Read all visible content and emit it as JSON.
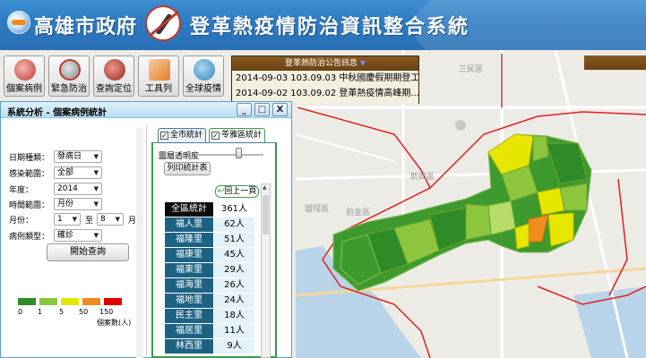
{
  "header": {
    "gov_title": "高雄市政府",
    "system_title": "登革熱疫情防治資訊整合系統"
  },
  "toolbar": {
    "items": [
      {
        "label": "個案病例",
        "icon": "case-chart-icon",
        "color": "#c0392b"
      },
      {
        "label": "緊急防治",
        "icon": "mosquito-ban-icon",
        "color": "#7f8c8d"
      },
      {
        "label": "查詢定位",
        "icon": "locate-pin-icon",
        "color": "#c0392b"
      },
      {
        "label": "工具列",
        "icon": "tools-icon",
        "color": "#e67e22"
      },
      {
        "label": "全球疫情",
        "icon": "globe-search-icon",
        "color": "#2e86c1"
      }
    ]
  },
  "bulletin": {
    "title": "登革熱防治公告訊息",
    "lines": [
      "2014-09-03 103.09.03 中秋國慶假期期登工",
      "2014-09-02 103.09.02 登革熱疫情高峰期..."
    ]
  },
  "panel": {
    "title": "系統分析 - 個案病例統計",
    "window_buttons": {
      "minimize": "_",
      "maximize": "□",
      "close": "X"
    },
    "filters": {
      "date_type": {
        "label": "日期種類：",
        "value": "發病日"
      },
      "source": {
        "label": "感染範圍：",
        "value": "全部"
      },
      "year": {
        "label": "年度：",
        "value": "2014"
      },
      "time_range": {
        "label": "時間範圍：",
        "value": "月份"
      },
      "month": {
        "label": "月份：",
        "from": "1",
        "to_label": "至",
        "to": "8",
        "unit": "月"
      },
      "case_type": {
        "label": "病例類型：",
        "value": "確診"
      }
    },
    "query_button": "開始查詢",
    "legend": {
      "colors": [
        "#2e8b28",
        "#8cc63e",
        "#e6e600",
        "#f08c1c",
        "#e00000"
      ],
      "labels": [
        "0",
        "1",
        "5",
        "50",
        "150"
      ],
      "unit": "個案數(人)"
    },
    "tabs": [
      {
        "label": "全市統計",
        "checked": "✓"
      },
      {
        "label": "苓雅區統計",
        "checked": "✓"
      }
    ],
    "opacity_label": "圖層透明度",
    "opacity": 0.62,
    "print_button": "列印統計表",
    "back_button": "回上一頁",
    "back_arrow": "↩",
    "stats": [
      {
        "name": "全區統計",
        "value": "361人"
      },
      {
        "name": "福人里",
        "value": "62人"
      },
      {
        "name": "福隆里",
        "value": "51人"
      },
      {
        "name": "福康里",
        "value": "45人"
      },
      {
        "name": "福東里",
        "value": "29人"
      },
      {
        "name": "福海里",
        "value": "26人"
      },
      {
        "name": "福地里",
        "value": "24人"
      },
      {
        "name": "民主里",
        "value": "18人"
      },
      {
        "name": "福居里",
        "value": "11人"
      },
      {
        "name": "林西里",
        "value": "9人"
      }
    ]
  },
  "map": {
    "labels": [
      "三民區",
      "前金區",
      "新興區",
      "鹽埕區"
    ]
  }
}
